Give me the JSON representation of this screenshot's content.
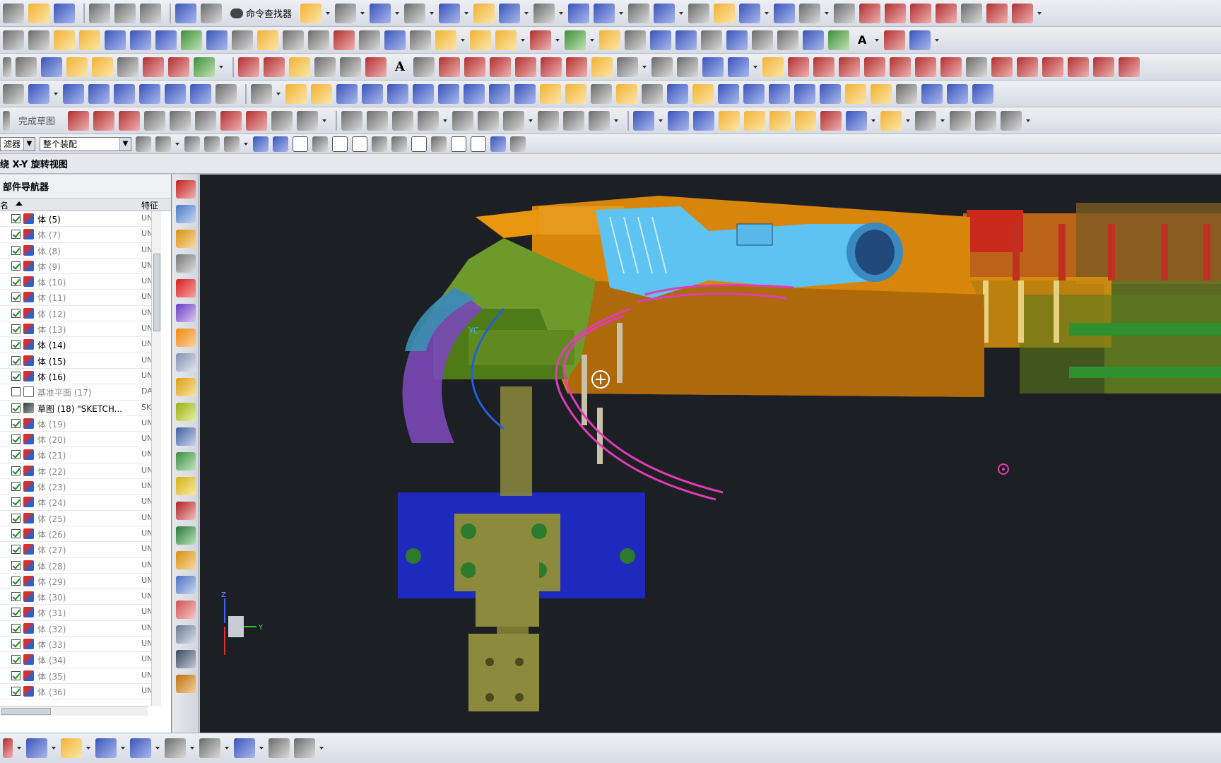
{
  "toolbar": {
    "command_finder_label": "命令查找器",
    "finish_sketch_label": "完成草图",
    "text_tool_label": "A"
  },
  "selection_bar": {
    "filter_label": "滤器",
    "scope_value": "整个装配"
  },
  "breadcrumb": {
    "text": "绕 X-Y 旋转视图"
  },
  "navigator": {
    "title": "部件导航器",
    "column_name": "名",
    "column_feature": "特征",
    "rows": [
      {
        "label": "体 (5)",
        "checked": true,
        "icon": "body",
        "feature": "UN",
        "dim": false
      },
      {
        "label": "体 (7)",
        "checked": true,
        "icon": "body",
        "feature": "UN",
        "dim": true
      },
      {
        "label": "体 (8)",
        "checked": true,
        "icon": "body",
        "feature": "UN",
        "dim": true
      },
      {
        "label": "体 (9)",
        "checked": true,
        "icon": "body",
        "feature": "UN",
        "dim": true
      },
      {
        "label": "体 (10)",
        "checked": true,
        "icon": "body",
        "feature": "UN",
        "dim": true
      },
      {
        "label": "体 (11)",
        "checked": true,
        "icon": "body",
        "feature": "UN",
        "dim": true
      },
      {
        "label": "体 (12)",
        "checked": true,
        "icon": "body",
        "feature": "UN",
        "dim": true
      },
      {
        "label": "体 (13)",
        "checked": true,
        "icon": "body",
        "feature": "UN",
        "dim": true
      },
      {
        "label": "体 (14)",
        "checked": true,
        "icon": "body",
        "feature": "UN",
        "dim": false
      },
      {
        "label": "体 (15)",
        "checked": true,
        "icon": "body",
        "feature": "UN",
        "dim": false
      },
      {
        "label": "体 (16)",
        "checked": true,
        "icon": "body",
        "feature": "UN",
        "dim": false
      },
      {
        "label": "基准平面 (17)",
        "checked": false,
        "icon": "plane",
        "feature": "DA",
        "dim": true
      },
      {
        "label": "草图 (18) \"SKETCH...",
        "checked": true,
        "icon": "sketch",
        "feature": "SK",
        "dim": false
      },
      {
        "label": "体 (19)",
        "checked": true,
        "icon": "body",
        "feature": "UN",
        "dim": true
      },
      {
        "label": "体 (20)",
        "checked": true,
        "icon": "body",
        "feature": "UN",
        "dim": true
      },
      {
        "label": "体 (21)",
        "checked": true,
        "icon": "body",
        "feature": "UN",
        "dim": true
      },
      {
        "label": "体 (22)",
        "checked": true,
        "icon": "body",
        "feature": "UN",
        "dim": true
      },
      {
        "label": "体 (23)",
        "checked": true,
        "icon": "body",
        "feature": "UN",
        "dim": true
      },
      {
        "label": "体 (24)",
        "checked": true,
        "icon": "body",
        "feature": "UN",
        "dim": true
      },
      {
        "label": "体 (25)",
        "checked": true,
        "icon": "body",
        "feature": "UN",
        "dim": true
      },
      {
        "label": "体 (26)",
        "checked": true,
        "icon": "body",
        "feature": "UN",
        "dim": true
      },
      {
        "label": "体 (27)",
        "checked": true,
        "icon": "body",
        "feature": "UN",
        "dim": true
      },
      {
        "label": "体 (28)",
        "checked": true,
        "icon": "body",
        "feature": "UN",
        "dim": true
      },
      {
        "label": "体 (29)",
        "checked": true,
        "icon": "body",
        "feature": "UN",
        "dim": true
      },
      {
        "label": "体 (30)",
        "checked": true,
        "icon": "body",
        "feature": "UN",
        "dim": true
      },
      {
        "label": "体 (31)",
        "checked": true,
        "icon": "body",
        "feature": "UN",
        "dim": true
      },
      {
        "label": "体 (32)",
        "checked": true,
        "icon": "body",
        "feature": "UN",
        "dim": true
      },
      {
        "label": "体 (33)",
        "checked": true,
        "icon": "body",
        "feature": "UN",
        "dim": true
      },
      {
        "label": "体 (34)",
        "checked": true,
        "icon": "body",
        "feature": "UN",
        "dim": true
      },
      {
        "label": "体 (35)",
        "checked": true,
        "icon": "body",
        "feature": "UN",
        "dim": true
      },
      {
        "label": "体 (36)",
        "checked": true,
        "icon": "body",
        "feature": "UN",
        "dim": true
      }
    ]
  },
  "viewport": {
    "triad_labels": {
      "z": "Z",
      "y": "Y"
    },
    "work_cs_label": "YC"
  },
  "colors": {
    "viewport_bg": "#1c1f24",
    "orange_part": "#d8850c",
    "green_part": "#6e9a2c",
    "cyan_part": "#5ec3f0",
    "blue_plate": "#1f2bd8",
    "olive_cylinder": "#8c8a3c",
    "magenta_curves": "#e03cb4",
    "red_part": "#d23220"
  }
}
